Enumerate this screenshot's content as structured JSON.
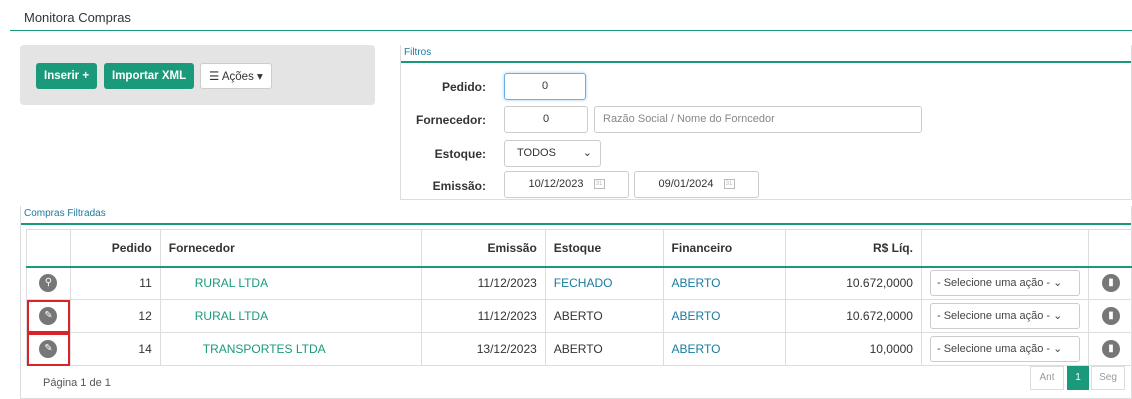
{
  "page": {
    "title": "Monitora Compras"
  },
  "toolbar": {
    "insert_label": "Inserir +",
    "import_label": "Importar XML",
    "actions_label": "☰ Ações ▾"
  },
  "filters": {
    "title": "Filtros",
    "pedido_label": "Pedido:",
    "pedido_value": "0",
    "fornecedor_label": "Fornecedor:",
    "fornecedor_code": "0",
    "fornecedor_placeholder": "Razão Social / Nome do Forncedor",
    "estoque_label": "Estoque:",
    "estoque_value": "TODOS",
    "emissao_label": "Emissão:",
    "date_from": "10/12/2023",
    "date_to": "09/01/2024"
  },
  "compras": {
    "title": "Compras Filtradas",
    "headers": [
      "Pedido",
      "Fornecedor",
      "Emissão",
      "Estoque",
      "Financeiro",
      "R$ Líq."
    ],
    "rows": [
      {
        "pedido": "11",
        "fornecedor": "RURAL LTDA",
        "emissao": "11/12/2023",
        "estoque": "FECHADO",
        "financeiro": "ABERTO",
        "liquido": "10.672,0000",
        "acao": "- Selecione uma ação -",
        "icon": "search-icon"
      },
      {
        "pedido": "12",
        "fornecedor": "RURAL LTDA",
        "emissao": "11/12/2023",
        "estoque": "ABERTO",
        "financeiro": "ABERTO",
        "liquido": "10.672,0000",
        "acao": "- Selecione uma ação -",
        "icon": "edit-icon"
      },
      {
        "pedido": "14",
        "fornecedor": "TRANSPORTES LTDA",
        "emissao": "13/12/2023",
        "estoque": "ABERTO",
        "financeiro": "ABERTO",
        "liquido": "10,0000",
        "acao": "- Selecione uma ação -",
        "icon": "edit-icon"
      }
    ],
    "page_info": "Página 1 de 1",
    "prev_label": "Ant",
    "current_page": "1",
    "next_label": "Seg"
  }
}
